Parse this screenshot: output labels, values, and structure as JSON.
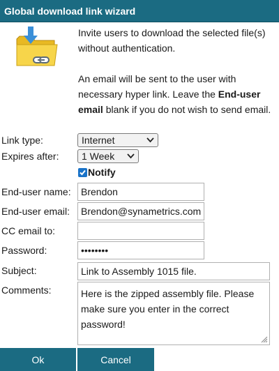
{
  "window": {
    "title": "Global download link wizard"
  },
  "icons": {
    "header": "folder-with-download-arrow-and-link"
  },
  "intro": {
    "line1": "Invite users to download the selected file(s) without authentication.",
    "line2_pre": "An email will be sent to the user with necessary hyper link. Leave the ",
    "line2_bold": "End-user email",
    "line2_post": " blank if you do not wish to send email."
  },
  "form": {
    "link_type": {
      "label": "Link type:",
      "value": "Internet"
    },
    "expires": {
      "label": "Expires after:",
      "value": "1 Week"
    },
    "notify": {
      "label": "Notify",
      "checked": true
    },
    "enduser_name": {
      "label": "End-user name:",
      "value": "Brendon"
    },
    "enduser_email": {
      "label": "End-user email:",
      "value": "Brendon@synametrics.com"
    },
    "cc_email": {
      "label": "CC email to:",
      "value": ""
    },
    "password": {
      "label": "Password:",
      "value": "12345678"
    },
    "subject": {
      "label": "Subject:",
      "value": "Link to Assembly 1015 file."
    },
    "comments": {
      "label": "Comments:",
      "value": "Here is the zipped assembly file. Please make sure you enter in the correct password!"
    }
  },
  "buttons": {
    "ok": "Ok",
    "cancel": "Cancel"
  },
  "colors": {
    "titlebar": "#1b6b82",
    "button": "#1b6b82",
    "checkbox": "#1a73c8"
  }
}
